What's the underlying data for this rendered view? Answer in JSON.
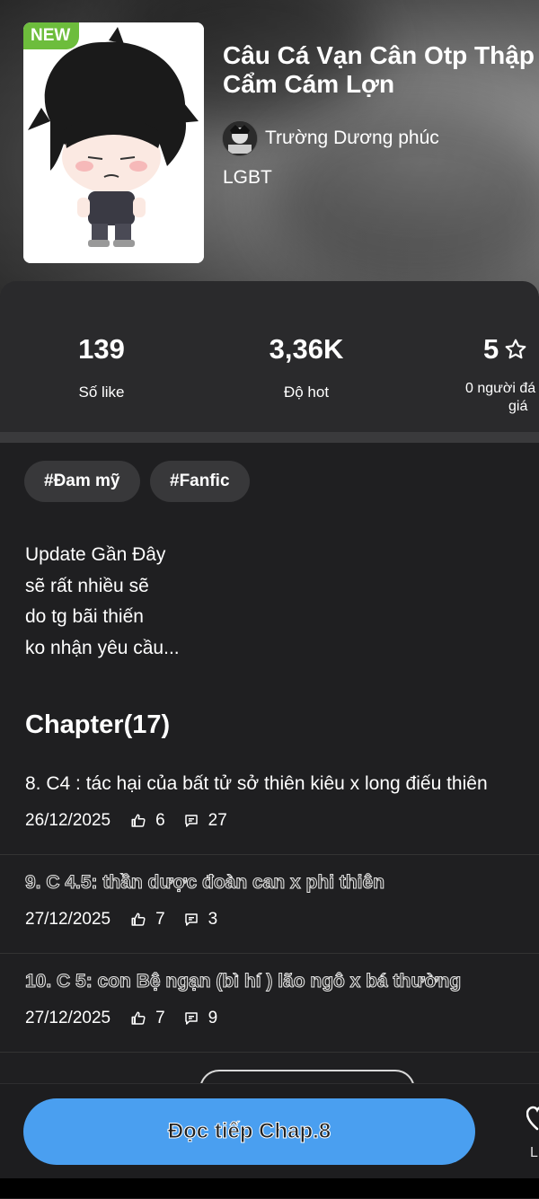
{
  "header": {
    "badge": "NEW",
    "title_line1": "Câu Cá Vạn Cân Otp Thập",
    "title_line2": "Cẩm Cám Lợn",
    "author": "Trường Dương phúc",
    "genre": "LGBT"
  },
  "stats": {
    "likes_value": "139",
    "likes_label": "Số like",
    "hot_value": "3,36K",
    "hot_label": "Độ hot",
    "rating_value": "5",
    "rating_label_line1": "0 người đá",
    "rating_label_line2": "giá"
  },
  "tags": [
    "#Đam mỹ",
    "#Fanfic"
  ],
  "description": [
    "Update Gần Đây",
    "sẽ rất nhiều sẽ",
    "do tg bãi thiến",
    "ko nhận yêu cầu..."
  ],
  "chapter_heading": "Chapter(17)",
  "chapters": [
    {
      "title": "8. C4 : tác hại của bất tử sở thiên kiêu x long điếu thiên",
      "date": "26/12/2025",
      "likes": "6",
      "comments": "27"
    },
    {
      "title": "9. C 4.5: thần dược đoàn can x phi thiên",
      "date": "27/12/2025",
      "likes": "7",
      "comments": "3"
    },
    {
      "title": "10. C 5: con Bệ ngạn (bì hí ) lão ngô x bá thường",
      "date": "27/12/2025",
      "likes": "7",
      "comments": "9"
    }
  ],
  "cta_label": "Đọc tiếp Chap.8",
  "side_label": "L",
  "icons": {
    "like": "thumbs-up-icon",
    "comment": "comment-icon",
    "star": "star-outline-icon",
    "side": "heart-icon"
  },
  "colors": {
    "accent": "#4a9ff0",
    "badge_green": "#6dbd3c",
    "panel": "#2a2a2c"
  }
}
